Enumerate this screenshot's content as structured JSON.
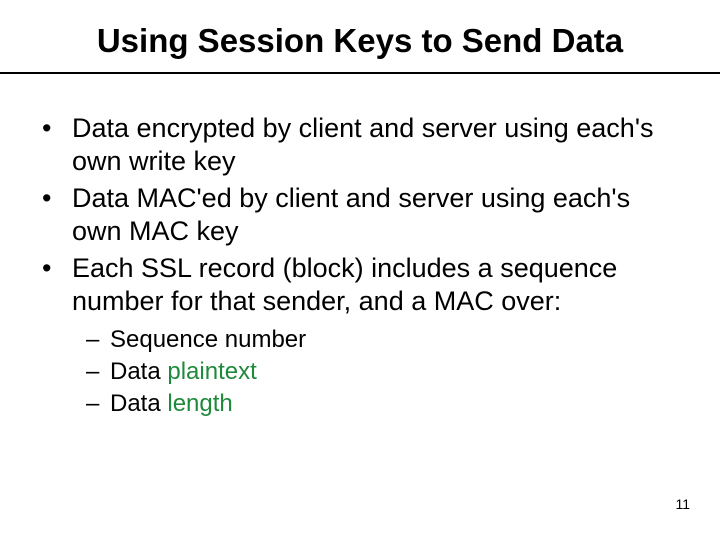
{
  "title": "Using Session Keys to Send Data",
  "bullets": {
    "b1": "Data encrypted by client and server using each's own write key",
    "b2": "Data MAC'ed by client and server using each's own MAC key",
    "b3": "Each SSL record (block) includes a sequence number for that sender, and a MAC over:"
  },
  "sub": {
    "s1": "Sequence number",
    "s2_pre": "Data ",
    "s2_hl": "plaintext",
    "s3_pre": "Data ",
    "s3_hl": "length"
  },
  "page_number": "11"
}
